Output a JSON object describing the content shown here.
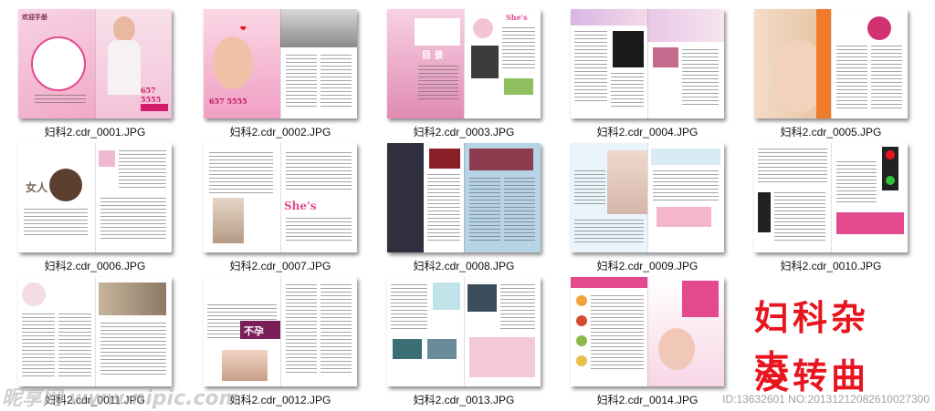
{
  "thumbnails": [
    {
      "filename": "妇科2.cdr_0001.JPG",
      "cover_left_text": "欢迎手册",
      "cover_phone": "657 5555"
    },
    {
      "filename": "妇科2.cdr_0002.JPG",
      "page_phone": "657 5555"
    },
    {
      "filename": "妇科2.cdr_0003.JPG",
      "page_heading": "目 录",
      "page_logo": "She's"
    },
    {
      "filename": "妇科2.cdr_0004.JPG"
    },
    {
      "filename": "妇科2.cdr_0005.JPG"
    },
    {
      "filename": "妇科2.cdr_0006.JPG",
      "page_heading": "女人"
    },
    {
      "filename": "妇科2.cdr_0007.JPG",
      "page_logo": "She's"
    },
    {
      "filename": "妇科2.cdr_0008.JPG"
    },
    {
      "filename": "妇科2.cdr_0009.JPG"
    },
    {
      "filename": "妇科2.cdr_0010.JPG"
    },
    {
      "filename": "妇科2.cdr_0011.JPG"
    },
    {
      "filename": "妇科2.cdr_0012.JPG",
      "page_heading": "不孕"
    },
    {
      "filename": "妇科2.cdr_0013.JPG"
    },
    {
      "filename": "妇科2.cdr_0014.JPG"
    }
  ],
  "title_line1": "妇科杂志",
  "title_line2": "没转曲",
  "watermark_left": "昵享网 www.nipic.com",
  "watermark_right": "ID:13632601 NO:20131212082610027300",
  "colors": {
    "accent_red": "#e8151f",
    "magazine_pink": "#e2498f",
    "magazine_blue": "#b7d3e6"
  }
}
